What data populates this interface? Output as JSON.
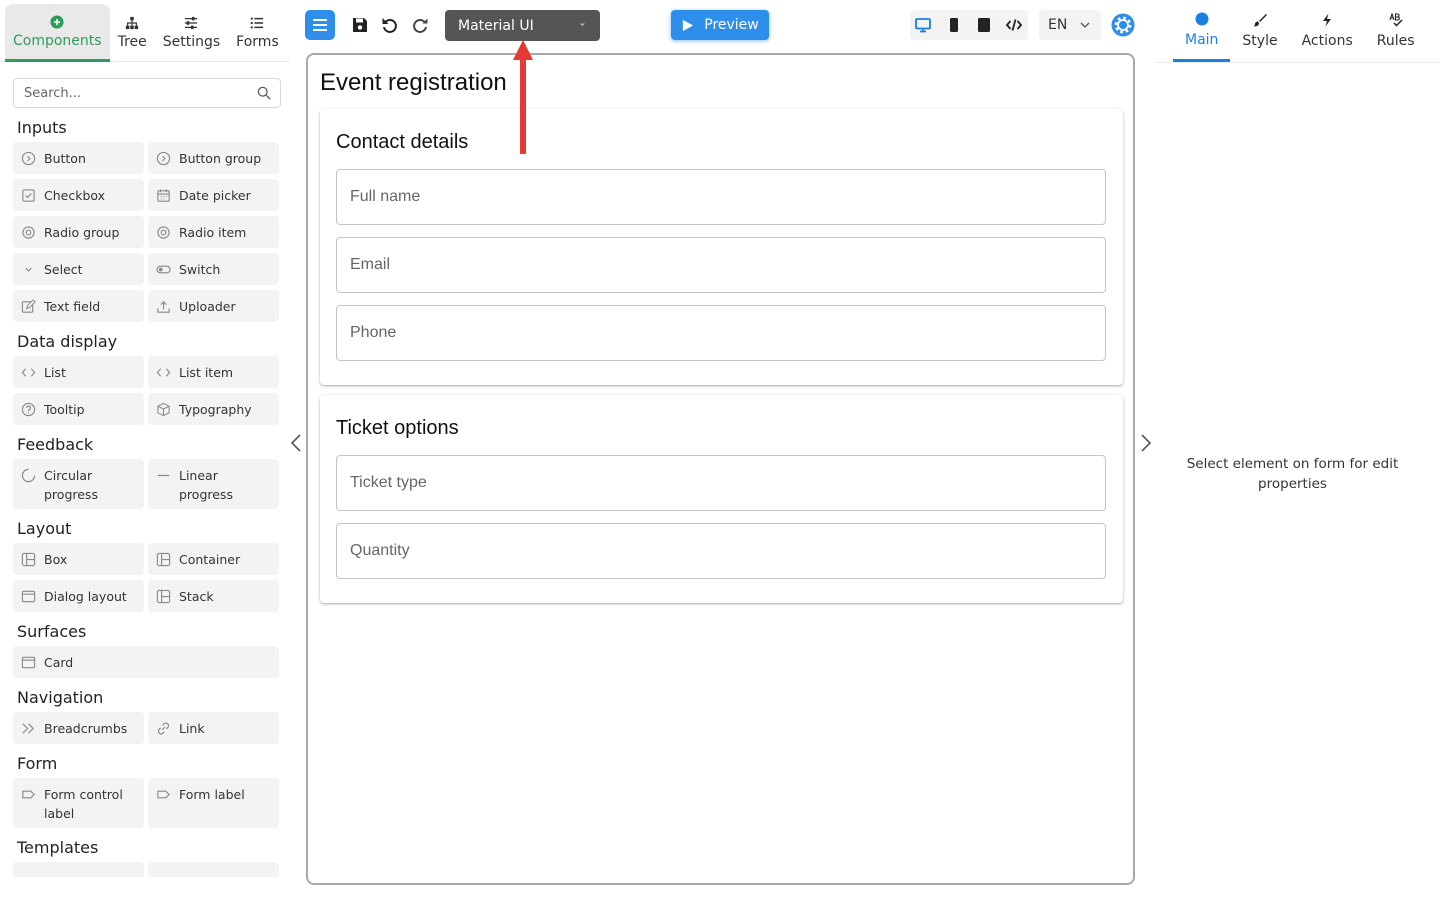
{
  "left_tabs": {
    "components": "Components",
    "tree": "Tree",
    "settings": "Settings",
    "forms": "Forms"
  },
  "search": {
    "placeholder": "Search..."
  },
  "sections": {
    "inputs": "Inputs",
    "data_display": "Data display",
    "feedback": "Feedback",
    "layout": "Layout",
    "surfaces": "Surfaces",
    "navigation": "Navigation",
    "form": "Form",
    "templates": "Templates"
  },
  "items": {
    "button": "Button",
    "button_group": "Button group",
    "checkbox": "Checkbox",
    "date_picker": "Date picker",
    "radio_group": "Radio group",
    "radio_item": "Radio item",
    "select": "Select",
    "switch": "Switch",
    "text_field": "Text field",
    "uploader": "Uploader",
    "list": "List",
    "list_item": "List item",
    "tooltip": "Tooltip",
    "typography": "Typography",
    "circular_progress": "Circular progress",
    "linear_progress": "Linear progress",
    "box": "Box",
    "container": "Container",
    "dialog_layout": "Dialog layout",
    "stack": "Stack",
    "card": "Card",
    "breadcrumbs": "Breadcrumbs",
    "link": "Link",
    "form_control_label": "Form control label",
    "form_label": "Form label"
  },
  "toolbar": {
    "theme": "Material UI",
    "preview": "Preview",
    "language": "EN"
  },
  "form": {
    "title": "Event registration",
    "card1_title": "Contact details",
    "full_name": "Full name",
    "email": "Email",
    "phone": "Phone",
    "card2_title": "Ticket options",
    "ticket_type": "Ticket type",
    "quantity": "Quantity"
  },
  "right_tabs": {
    "main": "Main",
    "style": "Style",
    "actions": "Actions",
    "rules": "Rules"
  },
  "right_panel": {
    "hint": "Select element on form for edit properties"
  },
  "colors": {
    "accent_green": "#2e9d5b",
    "accent_blue": "#2f8eea",
    "annotation_red": "#e53935"
  }
}
